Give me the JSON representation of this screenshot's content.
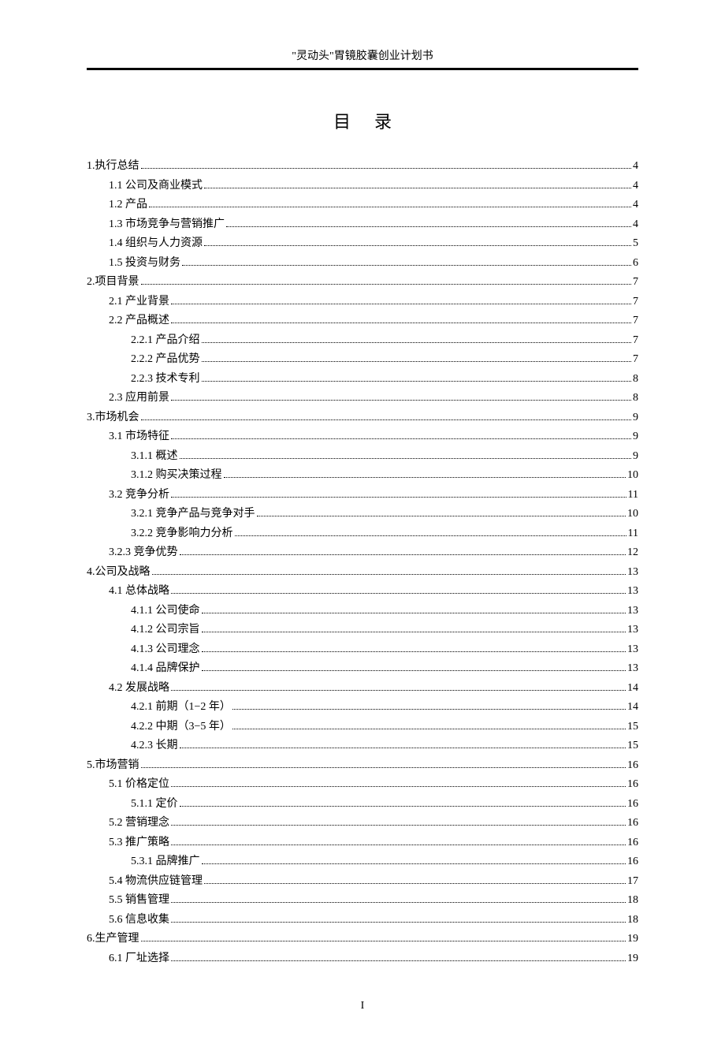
{
  "header": "\"灵动头\"胃镜胶囊创业计划书",
  "toc_title": "目录",
  "footer": "I",
  "toc": [
    {
      "level": 0,
      "label": "1.执行总结",
      "page": "4"
    },
    {
      "level": 1,
      "label": "1.1 公司及商业模式",
      "page": "4"
    },
    {
      "level": 1,
      "label": "1.2 产品",
      "page": "4"
    },
    {
      "level": 1,
      "label": "1.3 市场竞争与营销推广",
      "page": "4"
    },
    {
      "level": 1,
      "label": "1.4 组织与人力资源",
      "page": "5"
    },
    {
      "level": 1,
      "label": "1.5 投资与财务",
      "page": "6"
    },
    {
      "level": 0,
      "label": "2.项目背景",
      "page": "7"
    },
    {
      "level": 1,
      "label": "2.1 产业背景",
      "page": "7"
    },
    {
      "level": 1,
      "label": "2.2 产品概述",
      "page": "7"
    },
    {
      "level": 2,
      "label": "2.2.1 产品介绍",
      "page": "7"
    },
    {
      "level": 2,
      "label": "2.2.2 产品优势",
      "page": "7"
    },
    {
      "level": 2,
      "label": "2.2.3 技术专利",
      "page": "8"
    },
    {
      "level": 1,
      "label": "2.3 应用前景",
      "page": "8"
    },
    {
      "level": 0,
      "label": "3.市场机会",
      "page": "9"
    },
    {
      "level": 1,
      "label": "3.1 市场特征",
      "page": "9"
    },
    {
      "level": 2,
      "label": "3.1.1 概述",
      "page": "9"
    },
    {
      "level": 2,
      "label": "3.1.2 购买决策过程",
      "page": "10"
    },
    {
      "level": 1,
      "label": "3.2 竞争分析",
      "page": "11"
    },
    {
      "level": 2,
      "label": "3.2.1 竞争产品与竞争对手",
      "page": "10"
    },
    {
      "level": 2,
      "label": "3.2.2 竞争影响力分析",
      "page": "11"
    },
    {
      "level": 1,
      "label": "3.2.3 竞争优势",
      "page": "12"
    },
    {
      "level": 0,
      "label": "4.公司及战略",
      "page": "13"
    },
    {
      "level": 1,
      "label": "4.1 总体战略",
      "page": "13"
    },
    {
      "level": 2,
      "label": "4.1.1 公司使命",
      "page": "13"
    },
    {
      "level": 2,
      "label": "4.1.2 公司宗旨",
      "page": "13"
    },
    {
      "level": 2,
      "label": "4.1.3 公司理念",
      "page": "13"
    },
    {
      "level": 2,
      "label": "4.1.4 品牌保护",
      "page": "13"
    },
    {
      "level": 1,
      "label": "4.2 发展战略",
      "page": "14"
    },
    {
      "level": 2,
      "label": "4.2.1 前期（1−2 年）",
      "page": "14"
    },
    {
      "level": 2,
      "label": "4.2.2 中期（3−5 年）",
      "page": "15"
    },
    {
      "level": 2,
      "label": "4.2.3 长期",
      "page": "15"
    },
    {
      "level": 0,
      "label": "5.市场营销",
      "page": "16"
    },
    {
      "level": 1,
      "label": "5.1 价格定位",
      "page": "16"
    },
    {
      "level": 2,
      "label": "5.1.1 定价",
      "page": "16"
    },
    {
      "level": 1,
      "label": "5.2 营销理念",
      "page": "16"
    },
    {
      "level": 1,
      "label": "5.3 推广策略",
      "page": "16"
    },
    {
      "level": 2,
      "label": "5.3.1 品牌推广",
      "page": "16"
    },
    {
      "level": 1,
      "label": "5.4 物流供应链管理",
      "page": "17"
    },
    {
      "level": 1,
      "label": "5.5 销售管理",
      "page": "18"
    },
    {
      "level": 1,
      "label": "5.6 信息收集",
      "page": "18"
    },
    {
      "level": 0,
      "label": "6.生产管理",
      "page": "19"
    },
    {
      "level": 1,
      "label": "6.1 厂址选择",
      "page": "19"
    }
  ]
}
